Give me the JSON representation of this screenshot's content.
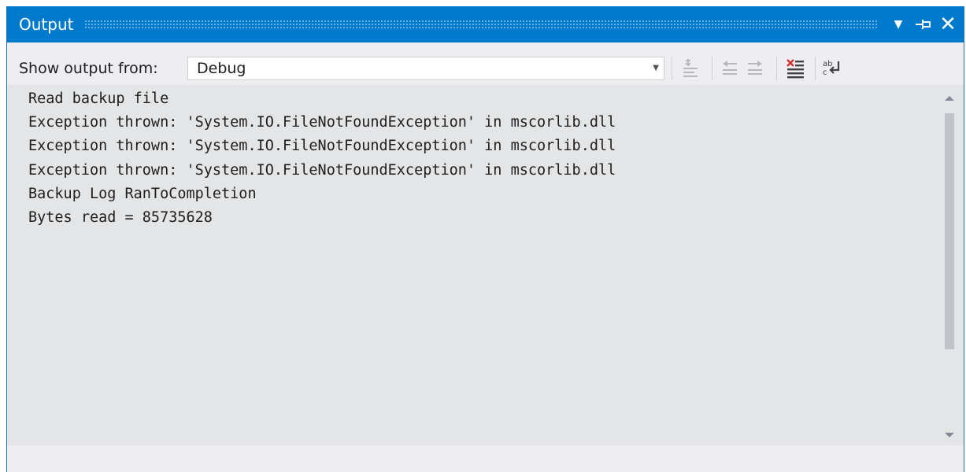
{
  "window": {
    "title": "Output",
    "accent_color": "#007acc",
    "controls": {
      "dropdown_icon": "window-menu-icon",
      "pin_icon": "pin-icon",
      "close_icon": "close-icon"
    }
  },
  "toolbar": {
    "show_output_label": "Show output from:",
    "source_selected": "Debug",
    "buttons": [
      {
        "name": "find-message-in-code-icon",
        "enabled": false
      },
      {
        "name": "go-to-previous-message-icon",
        "enabled": false
      },
      {
        "name": "go-to-next-message-icon",
        "enabled": false
      },
      {
        "name": "clear-all-icon",
        "enabled": true
      },
      {
        "name": "toggle-word-wrap-icon",
        "enabled": true
      }
    ]
  },
  "output": {
    "lines": [
      "Read backup file",
      "Exception thrown: 'System.IO.FileNotFoundException' in mscorlib.dll",
      "Exception thrown: 'System.IO.FileNotFoundException' in mscorlib.dll",
      "Exception thrown: 'System.IO.FileNotFoundException' in mscorlib.dll",
      "Backup Log RanToCompletion",
      "Bytes read = 85735628"
    ]
  }
}
